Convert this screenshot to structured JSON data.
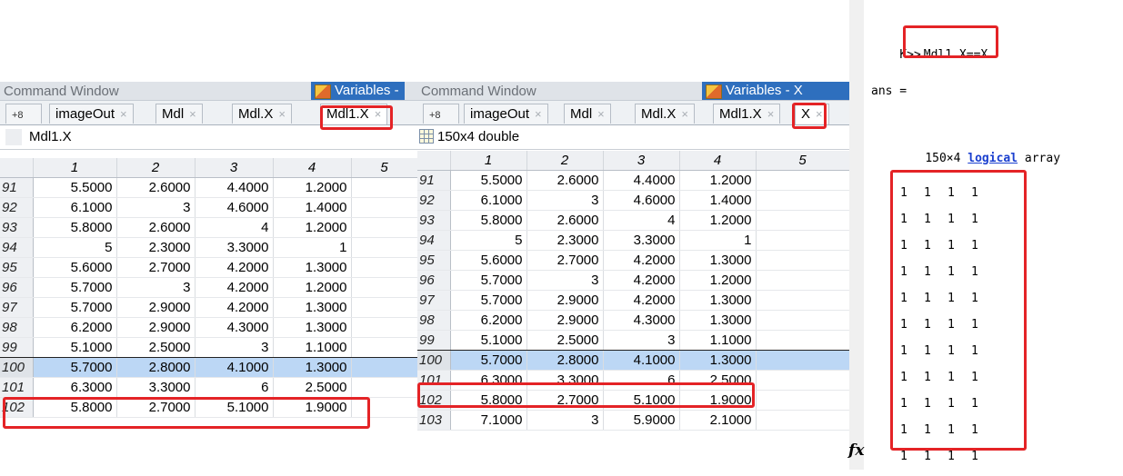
{
  "left_pane": {
    "titlebar": {
      "command_window": "Command Window",
      "variables": "Variables -"
    },
    "tabs": [
      {
        "label": "+8"
      },
      {
        "label": "imageOut"
      },
      {
        "label": "Mdl"
      },
      {
        "label": "Mdl.X"
      },
      {
        "label": "Mdl1.X"
      }
    ],
    "variable_name": "Mdl1.X",
    "columns": [
      "1",
      "2",
      "3",
      "4",
      "5"
    ],
    "rows": [
      {
        "index": "91",
        "values": [
          "5.5000",
          "2.6000",
          "4.4000",
          "1.2000"
        ]
      },
      {
        "index": "92",
        "values": [
          "6.1000",
          "3",
          "4.6000",
          "1.4000"
        ]
      },
      {
        "index": "93",
        "values": [
          "5.8000",
          "2.6000",
          "4",
          "1.2000"
        ]
      },
      {
        "index": "94",
        "values": [
          "5",
          "2.3000",
          "3.3000",
          "1"
        ]
      },
      {
        "index": "95",
        "values": [
          "5.6000",
          "2.7000",
          "4.2000",
          "1.3000"
        ]
      },
      {
        "index": "96",
        "values": [
          "5.7000",
          "3",
          "4.2000",
          "1.2000"
        ]
      },
      {
        "index": "97",
        "values": [
          "5.7000",
          "2.9000",
          "4.2000",
          "1.3000"
        ]
      },
      {
        "index": "98",
        "values": [
          "6.2000",
          "2.9000",
          "4.3000",
          "1.3000"
        ]
      },
      {
        "index": "99",
        "values": [
          "5.1000",
          "2.5000",
          "3",
          "1.1000"
        ]
      },
      {
        "index": "100",
        "values": [
          "5.7000",
          "2.8000",
          "4.1000",
          "1.3000"
        ]
      },
      {
        "index": "101",
        "values": [
          "6.3000",
          "3.3000",
          "6",
          "2.5000"
        ]
      },
      {
        "index": "102",
        "values": [
          "5.8000",
          "2.7000",
          "5.1000",
          "1.9000"
        ]
      }
    ]
  },
  "mid_pane": {
    "titlebar": {
      "command_window": "Command Window",
      "variables": "Variables - X"
    },
    "tabs": [
      {
        "label": "+8"
      },
      {
        "label": "imageOut"
      },
      {
        "label": "Mdl"
      },
      {
        "label": "Mdl.X"
      },
      {
        "label": "Mdl1.X"
      },
      {
        "label": "X"
      }
    ],
    "variable_info": "150x4 double",
    "columns": [
      "1",
      "2",
      "3",
      "4",
      "5"
    ],
    "rows": [
      {
        "index": "91",
        "values": [
          "5.5000",
          "2.6000",
          "4.4000",
          "1.2000"
        ]
      },
      {
        "index": "92",
        "values": [
          "6.1000",
          "3",
          "4.6000",
          "1.4000"
        ]
      },
      {
        "index": "93",
        "values": [
          "5.8000",
          "2.6000",
          "4",
          "1.2000"
        ]
      },
      {
        "index": "94",
        "values": [
          "5",
          "2.3000",
          "3.3000",
          "1"
        ]
      },
      {
        "index": "95",
        "values": [
          "5.6000",
          "2.7000",
          "4.2000",
          "1.3000"
        ]
      },
      {
        "index": "96",
        "values": [
          "5.7000",
          "3",
          "4.2000",
          "1.2000"
        ]
      },
      {
        "index": "97",
        "values": [
          "5.7000",
          "2.9000",
          "4.2000",
          "1.3000"
        ]
      },
      {
        "index": "98",
        "values": [
          "6.2000",
          "2.9000",
          "4.3000",
          "1.3000"
        ]
      },
      {
        "index": "99",
        "values": [
          "5.1000",
          "2.5000",
          "3",
          "1.1000"
        ]
      },
      {
        "index": "100",
        "values": [
          "5.7000",
          "2.8000",
          "4.1000",
          "1.3000"
        ]
      },
      {
        "index": "101",
        "values": [
          "6.3000",
          "3.3000",
          "6",
          "2.5000"
        ]
      },
      {
        "index": "102",
        "values": [
          "5.8000",
          "2.7000",
          "5.1000",
          "1.9000"
        ]
      },
      {
        "index": "103",
        "values": [
          "7.1000",
          "3",
          "5.9000",
          "2.1000"
        ]
      }
    ]
  },
  "console": {
    "prompt": "K>>",
    "command": "Mdl1.X==X",
    "ans_label": "ans =",
    "size_text": "150×4",
    "type_link": "logical",
    "type_suffix": "array",
    "matrix_rows": [
      [
        "1",
        "1",
        "1",
        "1"
      ],
      [
        "1",
        "1",
        "1",
        "1"
      ],
      [
        "1",
        "1",
        "1",
        "1"
      ],
      [
        "1",
        "1",
        "1",
        "1"
      ],
      [
        "1",
        "1",
        "1",
        "1"
      ],
      [
        "1",
        "1",
        "1",
        "1"
      ],
      [
        "1",
        "1",
        "1",
        "1"
      ],
      [
        "1",
        "1",
        "1",
        "1"
      ],
      [
        "1",
        "1",
        "1",
        "1"
      ],
      [
        "1",
        "1",
        "1",
        "1"
      ],
      [
        "1",
        "1",
        "1",
        "1"
      ]
    ],
    "fx_glyph": "fx"
  },
  "colors": {
    "highlight": "#e42326",
    "selection": "#bcd7f5",
    "link": "#1a3fcf"
  }
}
